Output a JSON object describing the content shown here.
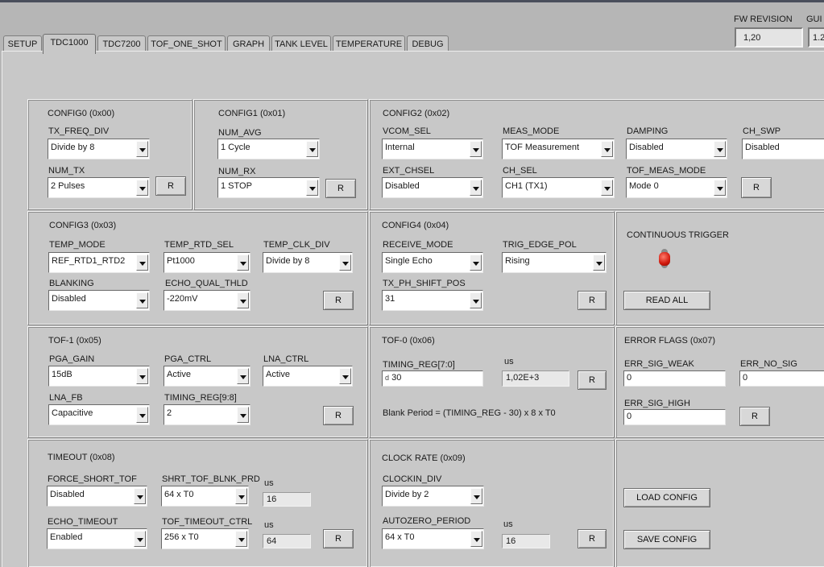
{
  "header": {
    "fw_revision_label": "FW REVISION",
    "fw_revision_value": "1,20",
    "gui_label": "GUI",
    "gui_value": "1.2"
  },
  "tabs": [
    "SETUP",
    "TDC1000",
    "TDC7200",
    "TOF_ONE_SHOT",
    "GRAPH",
    "TANK LEVEL",
    "TEMPERATURE",
    "DEBUG"
  ],
  "active_tab": "TDC1000",
  "reset_label": "R",
  "config0": {
    "title": "CONFIG0 (0x00)",
    "tx_freq_div_label": "TX_FREQ_DIV",
    "tx_freq_div": "Divide by 8",
    "num_tx_label": "NUM_TX",
    "num_tx": "2 Pulses"
  },
  "config1": {
    "title": "CONFIG1 (0x01)",
    "num_avg_label": "NUM_AVG",
    "num_avg": "1 Cycle",
    "num_rx_label": "NUM_RX",
    "num_rx": "1 STOP"
  },
  "config2": {
    "title": "CONFIG2 (0x02)",
    "vcom_sel_label": "VCOM_SEL",
    "vcom_sel": "Internal",
    "meas_mode_label": "MEAS_MODE",
    "meas_mode": "TOF Measurement",
    "damping_label": "DAMPING",
    "damping": "Disabled",
    "ch_swp_label": "CH_SWP",
    "ch_swp": "Disabled",
    "ext_chsel_label": "EXT_CHSEL",
    "ext_chsel": "Disabled",
    "ch_sel_label": "CH_SEL",
    "ch_sel": "CH1 (TX1)",
    "tof_meas_mode_label": "TOF_MEAS_MODE",
    "tof_meas_mode": "Mode 0"
  },
  "config3": {
    "title": "CONFIG3 (0x03)",
    "temp_mode_label": "TEMP_MODE",
    "temp_mode": "REF_RTD1_RTD2",
    "temp_rtd_sel_label": "TEMP_RTD_SEL",
    "temp_rtd_sel": "Pt1000",
    "temp_clk_div_label": "TEMP_CLK_DIV",
    "temp_clk_div": "Divide by 8",
    "blanking_label": "BLANKING",
    "blanking": "Disabled",
    "echo_qual_thld_label": "ECHO_QUAL_THLD",
    "echo_qual_thld": "-220mV"
  },
  "config4": {
    "title": "CONFIG4 (0x04)",
    "receive_mode_label": "RECEIVE_MODE",
    "receive_mode": "Single Echo",
    "trig_edge_pol_label": "TRIG_EDGE_POL",
    "trig_edge_pol": "Rising",
    "tx_ph_shift_pos_label": "TX_PH_SHIFT_POS",
    "tx_ph_shift_pos": "31"
  },
  "trigger": {
    "continuous_trigger_label": "CONTINUOUS TRIGGER",
    "read_all_label": "READ ALL"
  },
  "tof1": {
    "title": "TOF-1 (0x05)",
    "pga_gain_label": "PGA_GAIN",
    "pga_gain": "15dB",
    "pga_ctrl_label": "PGA_CTRL",
    "pga_ctrl": "Active",
    "lna_ctrl_label": "LNA_CTRL",
    "lna_ctrl": "Active",
    "lna_fb_label": "LNA_FB",
    "lna_fb": "Capacitive",
    "timing_reg_hi_label": "TIMING_REG[9:8]",
    "timing_reg_hi": "2"
  },
  "tof0": {
    "title": "TOF-0 (0x06)",
    "timing_reg_lo_label": "TIMING_REG[7:0]",
    "timing_reg_radix": "d",
    "timing_reg_lo": "30",
    "us_label": "us",
    "us_value": "1,02E+3",
    "blank_period_text": "Blank Period = (TIMING_REG - 30) x 8 x T0"
  },
  "error_flags": {
    "title": "ERROR FLAGS (0x07)",
    "err_sig_weak_label": "ERR_SIG_WEAK",
    "err_sig_weak": "0",
    "err_no_sig_label": "ERR_NO_SIG",
    "err_no_sig": "0",
    "err_sig_high_label": "ERR_SIG_HIGH",
    "err_sig_high": "0"
  },
  "timeout": {
    "title": "TIMEOUT (0x08)",
    "force_short_tof_label": "FORCE_SHORT_TOF",
    "force_short_tof": "Disabled",
    "shrt_tof_blnk_prd_label": "SHRT_TOF_BLNK_PRD",
    "shrt_tof_blnk_prd": "64 x T0",
    "us_label_1": "us",
    "us_value_1": "16",
    "echo_timeout_label": "ECHO_TIMEOUT",
    "echo_timeout": "Enabled",
    "tof_timeout_ctrl_label": "TOF_TIMEOUT_CTRL",
    "tof_timeout_ctrl": "256 x T0",
    "us_label_2": "us",
    "us_value_2": "64"
  },
  "clock_rate": {
    "title": "CLOCK RATE (0x09)",
    "clockin_div_label": "CLOCKIN_DIV",
    "clockin_div": "Divide by 2",
    "autozero_period_label": "AUTOZERO_PERIOD",
    "autozero_period": "64 x T0",
    "us_label": "us",
    "us_value": "16"
  },
  "config_actions": {
    "load_label": "LOAD CONFIG",
    "save_label": "SAVE CONFIG"
  }
}
